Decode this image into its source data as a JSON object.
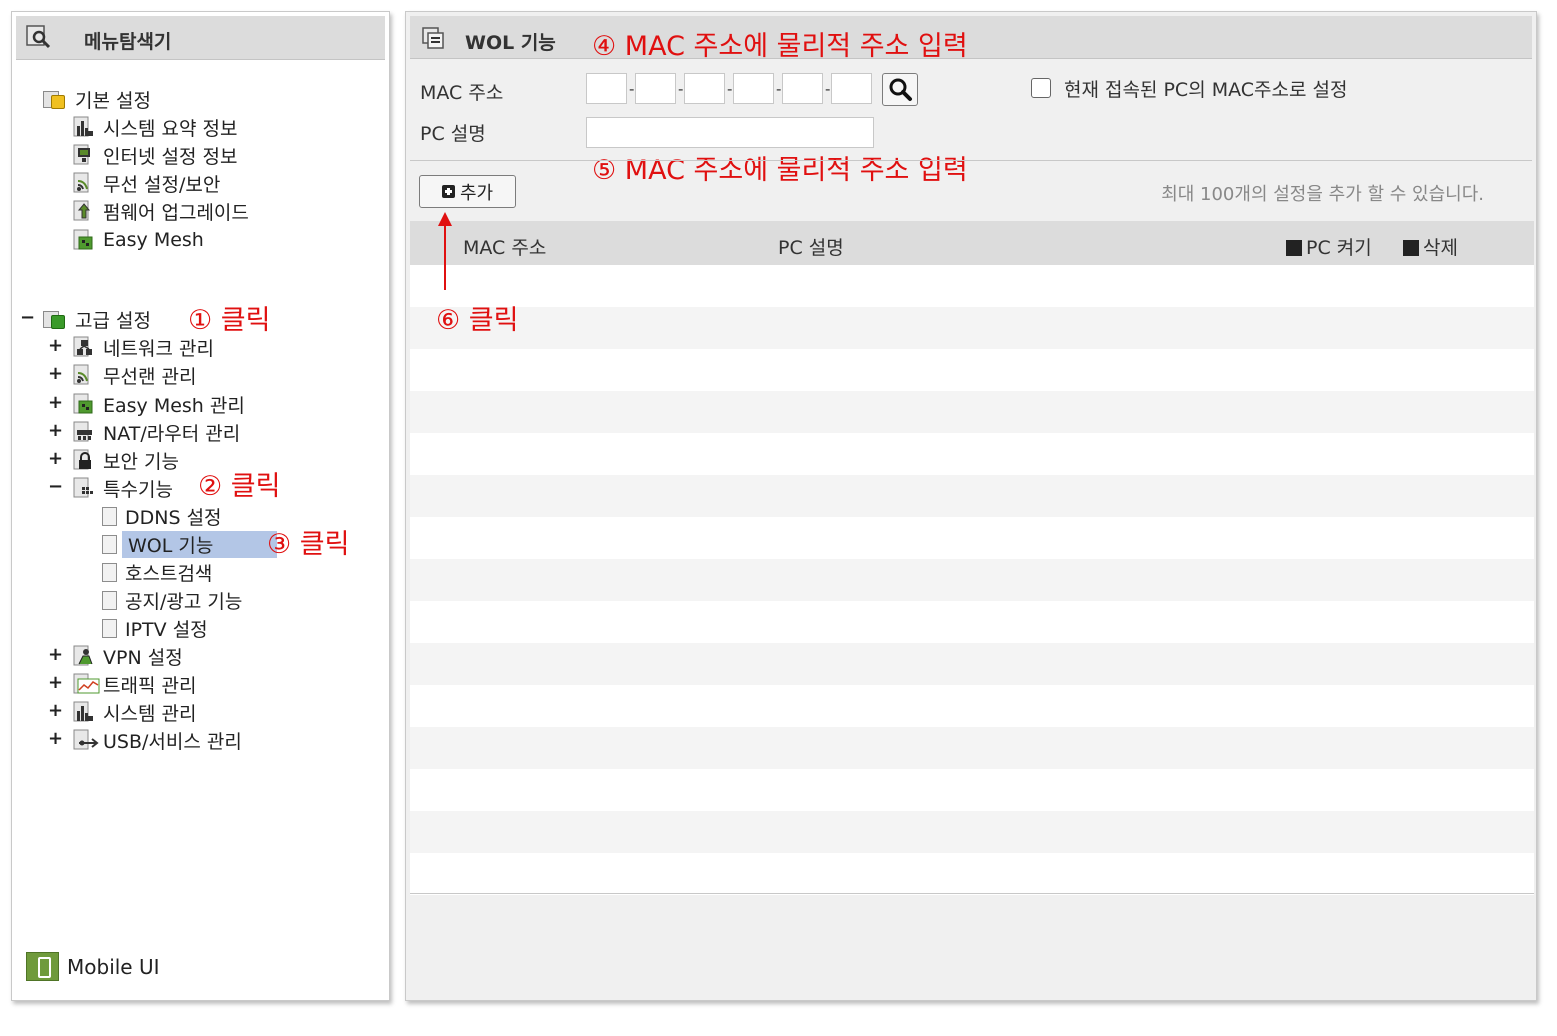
{
  "left_menu": {
    "title": "메뉴탐색기",
    "basic": {
      "label": "기본 설정",
      "items": [
        "시스템 요약 정보",
        "인터넷 설정 정보",
        "무선 설정/보안",
        "펌웨어 업그레이드",
        "Easy Mesh"
      ]
    },
    "advanced": {
      "label": "고급 설정",
      "items": [
        "네트워크 관리",
        "무선랜 관리",
        "Easy Mesh 관리",
        "NAT/라우터 관리",
        "보안 기능",
        "특수기능"
      ],
      "special_children": [
        "DDNS 설정",
        "WOL 기능",
        "호스트검색",
        "공지/광고 기능",
        "IPTV 설정"
      ],
      "after_items": [
        "VPN 설정",
        "트래픽 관리",
        "시스템 관리",
        "USB/서비스 관리"
      ]
    },
    "mobile_ui_label": "Mobile UI"
  },
  "content": {
    "title": "WOL 기능",
    "mac_label": "MAC 주소",
    "pc_desc_label": "PC 설명",
    "dash": "-",
    "checkbox_label": "현재 접속된 PC의 MAC주소로 설정",
    "add_button_label": "추가",
    "limit_note": "최대 100개의 설정을 추가 할 수 있습니다.",
    "table_headers": {
      "mac": "MAC 주소",
      "desc": "PC 설명",
      "wake": "PC 켜기",
      "delete": "삭제"
    }
  },
  "annotations": {
    "a1": "① 클릭",
    "a2": "② 클릭",
    "a3": "③ 클릭",
    "a4": "④ MAC 주소에 물리적 주소 입력",
    "a5": "⑤ MAC 주소에 물리적 주소 입력",
    "a6": "⑥ 클릭"
  },
  "colors": {
    "annotation": "#e01010",
    "selected_bg": "#b3c6e6",
    "header_bg": "#dcdcdc"
  }
}
